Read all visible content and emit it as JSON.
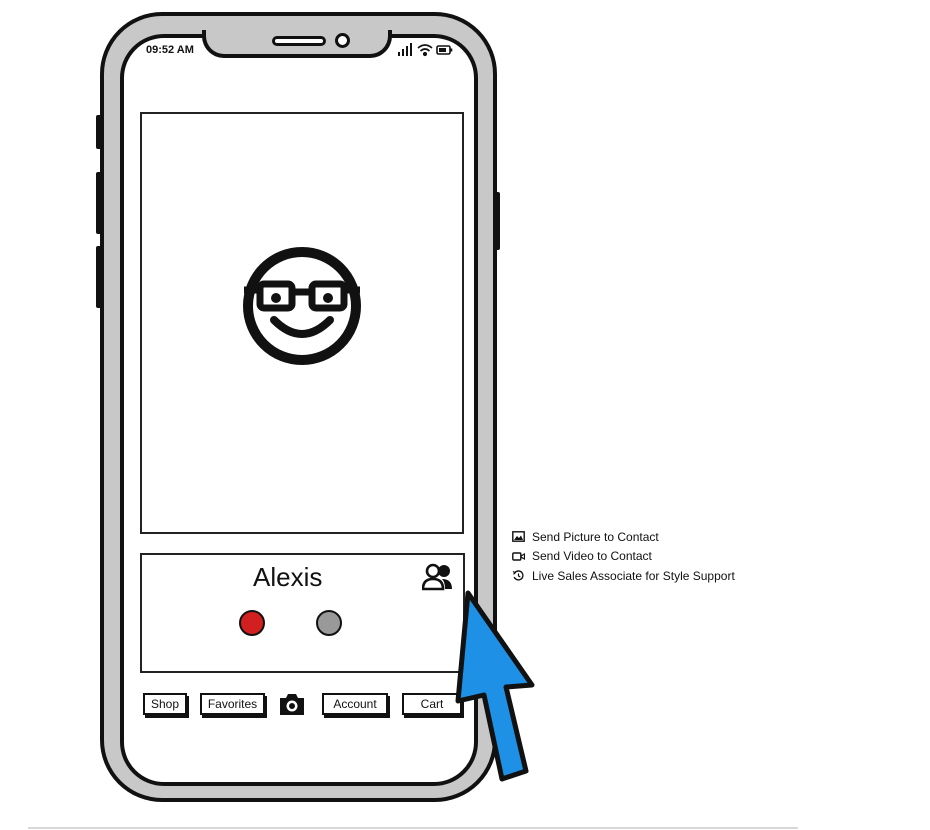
{
  "status_bar": {
    "time": "09:52 AM"
  },
  "contact": {
    "name": "Alexis",
    "accept_color": "#d21f1f",
    "decline_color": "#999999"
  },
  "nav": {
    "shop": "Shop",
    "favorites": "Favorites",
    "account": "Account",
    "cart": "Cart"
  },
  "menu": {
    "items": [
      {
        "icon": "image-icon",
        "label": "Send Picture to Contact"
      },
      {
        "icon": "video-icon",
        "label": "Send Video to Contact"
      },
      {
        "icon": "history-icon",
        "label": "Live Sales Associate for Style Support"
      }
    ]
  },
  "colors": {
    "arrow": "#1e90e6",
    "frame": "#c8c8c8"
  }
}
